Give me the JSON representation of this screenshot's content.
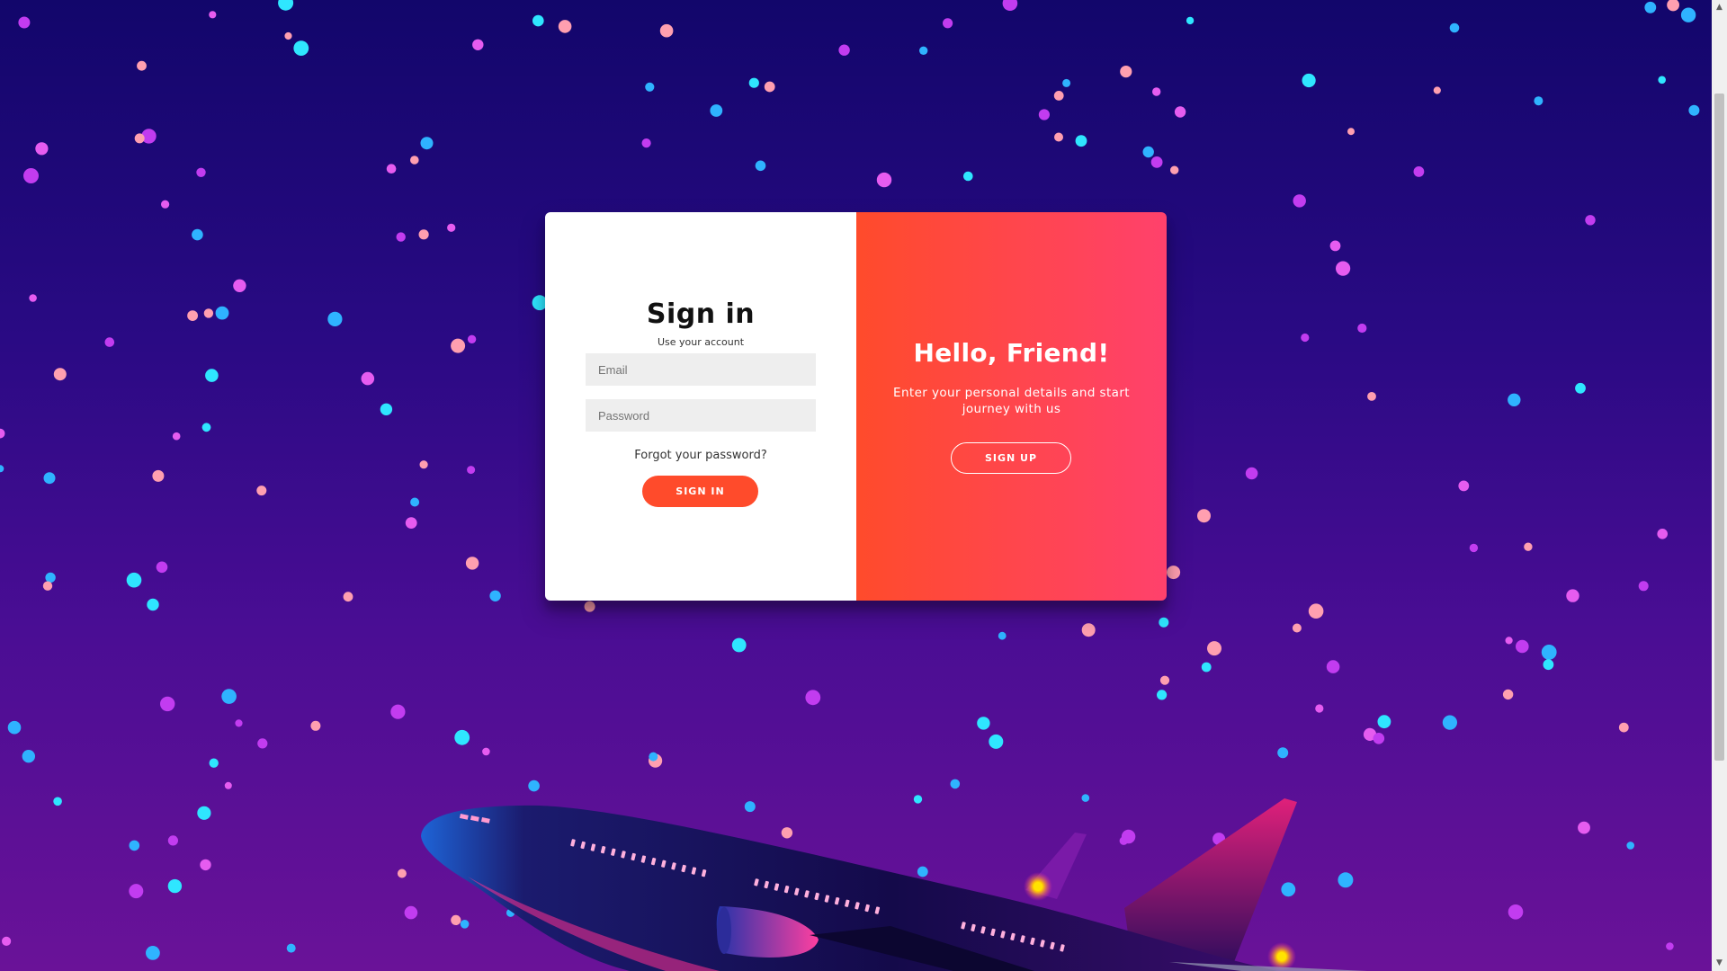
{
  "signin": {
    "title": "Sign in",
    "subtitle": "Use your account",
    "email_placeholder": "Email",
    "password_placeholder": "Password",
    "forgot_label": "Forgot your password?",
    "button_label": "SIGN IN"
  },
  "overlay": {
    "title": "Hello, Friend!",
    "text": "Enter your personal details and start journey with us",
    "button_label": "SIGN UP"
  },
  "colors": {
    "accent": "#ff4b2b",
    "accent_gradient_end": "#ff416c",
    "background_top": "#12066b",
    "background_bottom": "#6a1298"
  },
  "icons": {
    "scroll_up": "scroll-up-arrow-icon",
    "scroll_down": "scroll-down-arrow-icon",
    "stars": "star-dots",
    "airplane": "airplane-illustration"
  }
}
